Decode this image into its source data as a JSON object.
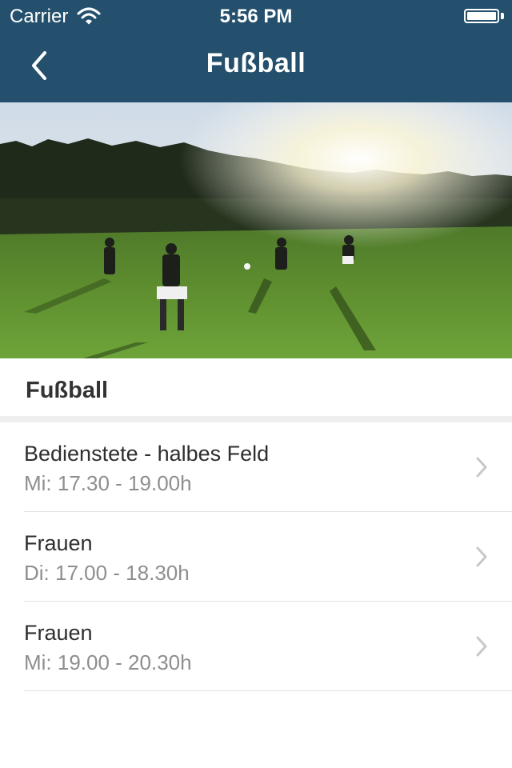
{
  "status_bar": {
    "carrier": "Carrier",
    "time": "5:56 PM"
  },
  "nav": {
    "title": "Fußball",
    "back_icon": "chevron-left-icon"
  },
  "hero": {
    "alt": "football-field-photo"
  },
  "section": {
    "title": "Fußball"
  },
  "list": {
    "items": [
      {
        "title": "Bedienstete - halbes Feld",
        "subtitle": "Mi: 17.30 - 19.00h"
      },
      {
        "title": "Frauen",
        "subtitle": "Di: 17.00 - 18.30h"
      },
      {
        "title": "Frauen",
        "subtitle": "Mi: 19.00 - 20.30h"
      }
    ],
    "chevron_icon": "chevron-right-icon"
  },
  "colors": {
    "nav_background": "#24506d",
    "title_text": "#2e2e2e",
    "subtitle_text": "#8e8e8e",
    "chevron": "#c7c7cc"
  }
}
